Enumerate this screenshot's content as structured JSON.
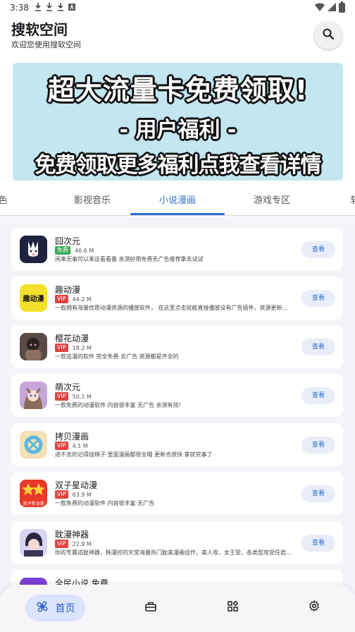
{
  "status_bar": {
    "time": "3:38",
    "notifications": [
      "download-icon",
      "download-icon",
      "download-icon",
      "app-notification-icon"
    ],
    "indicators": [
      "wifi-icon",
      "signal-icon",
      "battery-icon"
    ]
  },
  "header": {
    "title": "搜软空间",
    "subtitle": "欢迎您使用搜软空间",
    "search_icon": "search-icon"
  },
  "banner": {
    "line1": "超大流量卡免费领取!",
    "line2": "- 用户福利 -",
    "line3": "免费领取更多福利点我查看详情",
    "background": "#c3e6f1"
  },
  "tabs": [
    {
      "label": "色",
      "active": false
    },
    {
      "label": "影视音乐",
      "active": false
    },
    {
      "label": "小说漫画",
      "active": true
    },
    {
      "label": "游戏专区",
      "active": false
    },
    {
      "label": "软",
      "active": false
    }
  ],
  "apps": [
    {
      "name": "囧次元",
      "badge": "免费",
      "badge_type": "free",
      "size": "46.6 M",
      "desc": "闲来无事可以来这看看番 亲测好用免费无广告推荐拿去试试",
      "button": "查看",
      "icon_color": "#1f2340"
    },
    {
      "name": "趣动漫",
      "badge": "VIP",
      "badge_type": "vip",
      "size": "44.2 M",
      "desc": "一款拥有海量优质动漫资源的播放软件， 在这里点击就能直接播放没有广告插件，资源更新...",
      "button": "查看",
      "icon_color": "#f5e02a",
      "icon_text": "趣动漫"
    },
    {
      "name": "樱花动漫",
      "badge": "VIP",
      "badge_type": "vip",
      "size": "18.2 M",
      "desc": "一款追漫的软件 完全免费 去广告 资源都是齐全的",
      "button": "查看",
      "icon_color": "#5a4a48"
    },
    {
      "name": "萌次元",
      "badge": "VIP",
      "badge_type": "vip",
      "size": "50.1 M",
      "desc": "一款免费的动漫软件 内容很丰富 无广告 亲测有效!",
      "button": "查看",
      "icon_color": "#c7a5d8"
    },
    {
      "name": "拷贝漫画",
      "badge": "VIP",
      "badge_type": "vip",
      "size": "4.1 M",
      "desc": "进不去的记得挂梯子 里面漫画都很全哦 更新也很快 拿就完事了",
      "button": "查看",
      "icon_color": "#f6e0b8"
    },
    {
      "name": "双子星动漫",
      "badge": "VIP",
      "badge_type": "vip",
      "size": "63.9 M",
      "desc": "一款免费的动漫软件 内容很丰富 无广告",
      "button": "查看",
      "icon_color": "#e8392a",
      "icon_text": "双子星动漫"
    },
    {
      "name": "耽漫神器",
      "badge": "VIP",
      "badge_type": "vip",
      "size": "22.9 M",
      "desc": "你的专属追耽神器，韩漫控的天堂海量热门耽美漫画佳作，美人攻，女王受，各类型攻受任君...",
      "button": "查看",
      "icon_color": "#d9d2f0"
    },
    {
      "name": "全民小说 免费",
      "badge": "",
      "badge_type": "",
      "size": "",
      "desc": "",
      "button": "",
      "icon_color": "#7b3fd6"
    }
  ],
  "bottom_nav": {
    "home_label": "首页",
    "items": [
      "fan-icon",
      "briefcase-icon",
      "apps-grid-icon",
      "settings-icon"
    ],
    "accent": "#2a5fbf"
  }
}
